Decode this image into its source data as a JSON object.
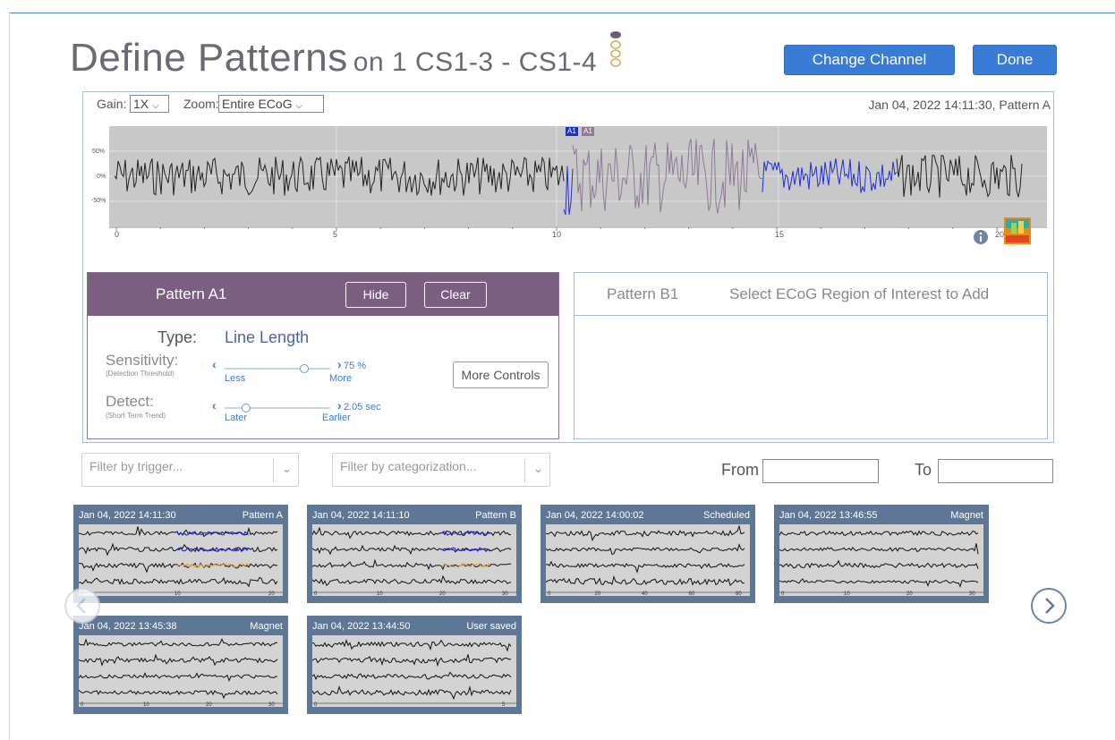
{
  "header": {
    "title": "Define Patterns",
    "subtitle": "on 1 CS1-3 - CS1-4",
    "change_channel_label": "Change Channel",
    "done_label": "Done"
  },
  "viewer": {
    "gain_label": "Gain:",
    "gain_value": "1X",
    "zoom_label": "Zoom:",
    "zoom_value": "Entire ECoG",
    "timestamp": "Jan 04, 2022 14:11:30, Pattern A",
    "y_ticks": [
      "50%",
      "0%",
      "-50%"
    ],
    "x_ticks": [
      "0",
      "5",
      "10",
      "15",
      "20"
    ],
    "marker_labels": [
      "A1",
      "A1"
    ],
    "info_icon": "info-icon",
    "spectrogram_icon": "spectrogram-icon"
  },
  "pattern_a": {
    "title": "Pattern A1",
    "hide_label": "Hide",
    "clear_label": "Clear",
    "type_label": "Type:",
    "type_value": "Line Length",
    "sensitivity_label": "Sensitivity:",
    "sensitivity_sub": "(Detection Threshold)",
    "sensitivity_less": "Less",
    "sensitivity_more": "More",
    "sensitivity_value": "75 %",
    "sensitivity_level": 0.75,
    "detect_label": "Detect:",
    "detect_sub": "(Short Term Trend)",
    "detect_later": "Later",
    "detect_earlier": "Earlier",
    "detect_value": "2.05 sec",
    "detect_level": 0.2,
    "more_controls_label": "More Controls"
  },
  "pattern_b": {
    "title": "Pattern B1",
    "hint": "Select ECoG Region of Interest to Add"
  },
  "filters": {
    "trigger_placeholder": "Filter by trigger...",
    "category_placeholder": "Filter by categorization...",
    "from_label": "From",
    "to_label": "To",
    "from_value": "",
    "to_value": ""
  },
  "thumbnails": [
    {
      "date": "Jan 04, 2022 14:11:30",
      "type": "Pattern A",
      "ticks": [
        "0",
        "10",
        "20"
      ]
    },
    {
      "date": "Jan 04, 2022 14:11:10",
      "type": "Pattern B",
      "ticks": [
        "0",
        "10",
        "20",
        "30"
      ]
    },
    {
      "date": "Jan 04, 2022 14:00:02",
      "type": "Scheduled",
      "ticks": [
        "0",
        "20",
        "40",
        "60",
        "80"
      ]
    },
    {
      "date": "Jan 04, 2022 13:46:55",
      "type": "Magnet",
      "ticks": [
        "0",
        "10",
        "20",
        "30"
      ]
    },
    {
      "date": "Jan 04, 2022 13:45:38",
      "type": "Magnet",
      "ticks": [
        "0",
        "10",
        "20",
        "30"
      ]
    },
    {
      "date": "Jan 04, 2022 13:44:50",
      "type": "User saved",
      "ticks": [
        "0",
        "5"
      ]
    }
  ],
  "colors": {
    "accent_blue": "#3a7bd5",
    "pattern_purple": "#7b5f80",
    "trace_blue": "#1f2fd6",
    "trace_mauve": "#8f7a98",
    "trace_orange": "#e7a33a"
  }
}
